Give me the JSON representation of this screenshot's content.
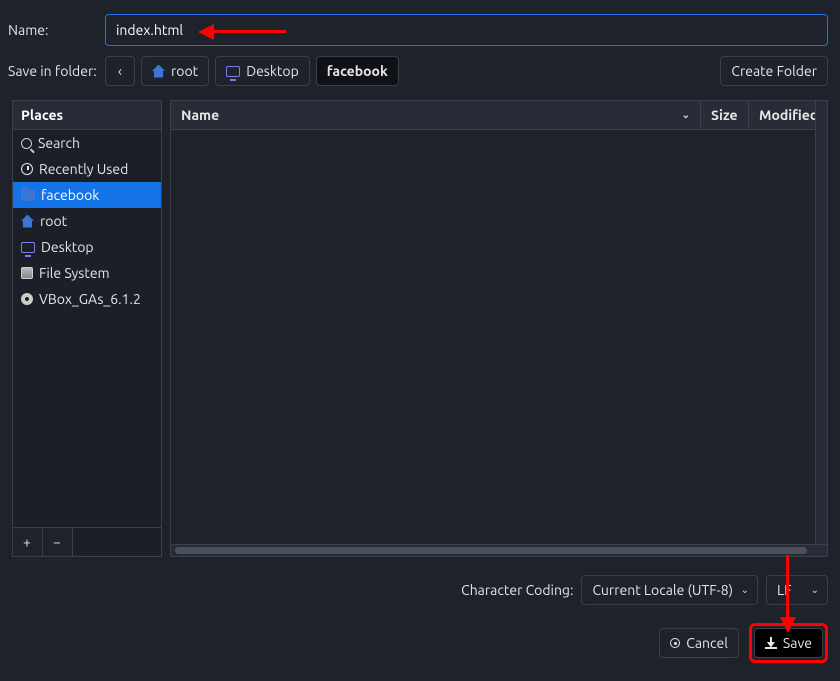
{
  "name_row": {
    "label": "Name:",
    "value": "index.html"
  },
  "folder_row": {
    "label": "Save in folder:",
    "back_icon": "chevron-left-icon",
    "crumbs": [
      {
        "label": "root",
        "icon": "home",
        "current": false
      },
      {
        "label": "Desktop",
        "icon": "monitor",
        "current": false
      },
      {
        "label": "facebook",
        "icon": null,
        "current": true
      }
    ],
    "create_folder": "Create Folder"
  },
  "places": {
    "header": "Places",
    "items": [
      {
        "label": "Search",
        "icon": "search",
        "selected": false
      },
      {
        "label": "Recently Used",
        "icon": "clock",
        "selected": false
      },
      {
        "label": "facebook",
        "icon": "folder",
        "selected": true
      },
      {
        "label": "root",
        "icon": "home",
        "selected": false
      },
      {
        "label": "Desktop",
        "icon": "monitor",
        "selected": false
      },
      {
        "label": "File System",
        "icon": "disk",
        "selected": false
      },
      {
        "label": "VBox_GAs_6.1.2",
        "icon": "disc",
        "selected": false
      }
    ],
    "add": "+",
    "remove": "−"
  },
  "columns": {
    "name": "Name",
    "size": "Size",
    "modified": "Modified"
  },
  "coding": {
    "label": "Character Coding:",
    "value": "Current Locale (UTF-8)",
    "line_ending": "LF"
  },
  "actions": {
    "cancel": "Cancel",
    "save": "Save"
  }
}
